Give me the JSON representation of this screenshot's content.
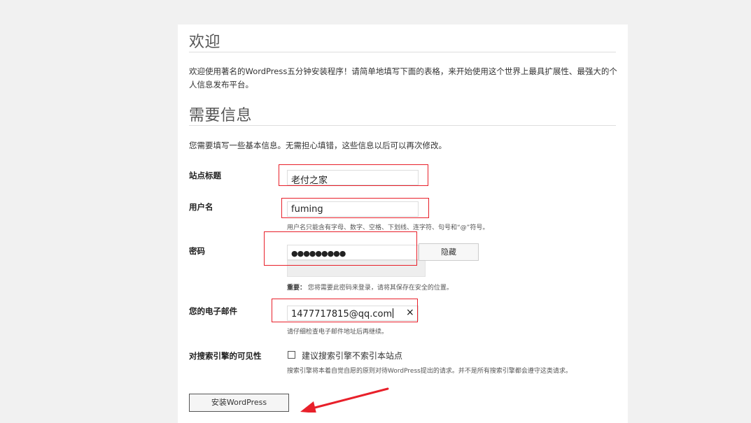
{
  "welcome": {
    "heading": "欢迎",
    "intro": "欢迎使用著名的WordPress五分钟安装程序！请简单地填写下面的表格，来开始使用这个世界上最具扩展性、最强大的个人信息发布平台。"
  },
  "info": {
    "heading": "需要信息",
    "intro": "您需要填写一些基本信息。无需担心填错，这些信息以后可以再次修改。"
  },
  "form": {
    "site_title": {
      "label": "站点标题",
      "value": "老付之家"
    },
    "username": {
      "label": "用户名",
      "value": "fuming",
      "hint": "用户名只能含有字母、数字、空格、下划线、连字符、句号和“@”符号。"
    },
    "password": {
      "label": "密码",
      "masked_value": "●●●●●●●●●",
      "hide_button": "隐藏",
      "hint_strong": "重要：",
      "hint": "您将需要此密码来登录，请将其保存在安全的位置。"
    },
    "email": {
      "label": "您的电子邮件",
      "value": "1477717815@qq.com",
      "clear_glyph": "×",
      "hint": "请仔细检查电子邮件地址后再继续。"
    },
    "visibility": {
      "label": "对搜索引擎的可见性",
      "checkbox_label": "建议搜索引擎不索引本站点",
      "checked": false,
      "hint": "搜索引擎将本着自觉自愿的原则对待WordPress提出的请求。并不是所有搜索引擎都会遵守这类请求。"
    },
    "submit_label": "安装WordPress"
  },
  "annotation_color": "#e8202a"
}
